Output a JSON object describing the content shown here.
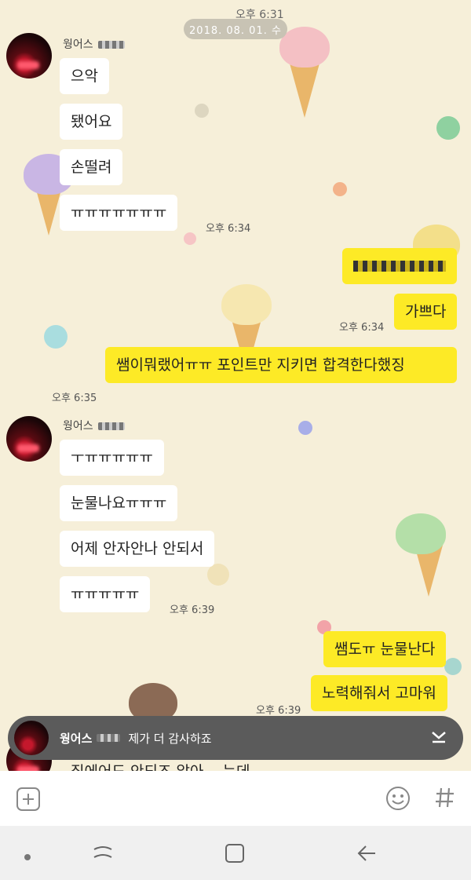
{
  "header": {
    "top_time": "오후 6:31",
    "date": "2018. 08. 01. 수"
  },
  "messages": [
    {
      "side": "left",
      "sender": "웡어스",
      "text": "으악"
    },
    {
      "side": "left",
      "text": "됐어요"
    },
    {
      "side": "left",
      "text": "손떨려"
    },
    {
      "side": "left",
      "text": "ㅠㅠㅠㅠㅠㅠㅠ",
      "time": "오후 6:34"
    },
    {
      "side": "right",
      "text": ""
    },
    {
      "side": "right",
      "text": "가쁘다",
      "time": "오후 6:34"
    },
    {
      "side": "right",
      "text": "쌤이뭐랬어ㅠㅠ 포인트만 지키면 합격한다했징",
      "time": "오후 6:35"
    },
    {
      "side": "left",
      "sender": "웡어스",
      "text": "ㅜㅠㅠㅠㅠㅠ"
    },
    {
      "side": "left",
      "text": "눈물나요ㅠㅠㅠ"
    },
    {
      "side": "left",
      "text": "어제 안자안나 안되서"
    },
    {
      "side": "left",
      "text": "ㅠㅠㅠㅠㅠ",
      "time": "오후 6:39"
    },
    {
      "side": "right",
      "text": "쌤도ㅠ 눈물난다"
    },
    {
      "side": "right",
      "text": "노력해줘서 고마워",
      "time": "오후 6:39"
    }
  ],
  "notification": {
    "name": "웡어스",
    "message": "제가 더 감사하죠",
    "icon": "chevron-down-icon"
  },
  "partial_message": "집에어도 안되즈 알아 ...는데",
  "input_bar": {
    "icons": [
      "plus-square-icon",
      "emoji-icon",
      "hashtag-icon"
    ]
  },
  "nav_bar": {
    "icons": [
      "dot-icon",
      "recent-apps-icon",
      "home-icon",
      "back-icon"
    ]
  }
}
